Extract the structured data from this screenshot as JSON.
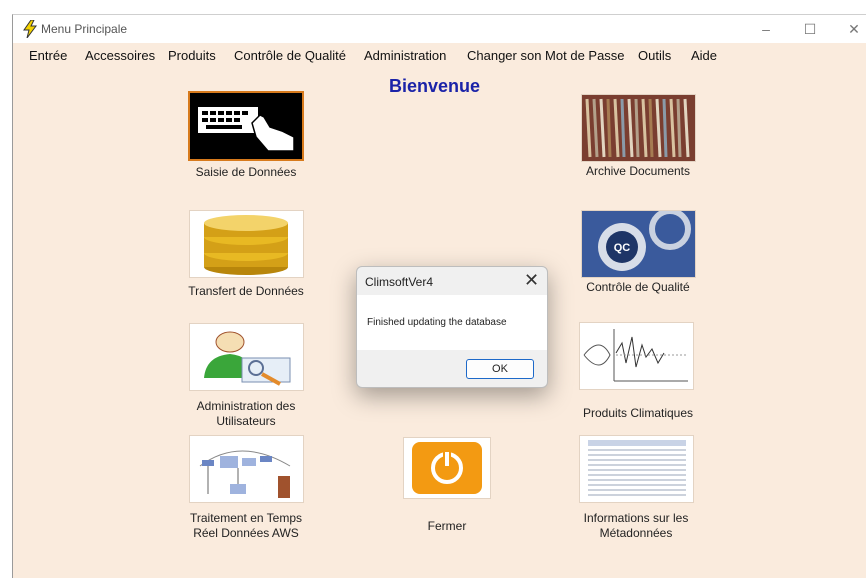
{
  "window": {
    "title": "Menu Principale"
  },
  "menu": [
    "Entrée",
    "Accessoires",
    "Produits",
    "Contrôle de Qualité",
    "Administration",
    "Changer son Mot de Passe",
    "Outils",
    "Aide"
  ],
  "welcome": "Bienvenue",
  "tiles": {
    "data_entry": "Saisie de Données",
    "data_transfer": "Transfert de Données",
    "user_admin_1": "Administration des",
    "user_admin_2": "Utilisateurs",
    "aws_1": "Traitement en Temps",
    "aws_2": "Réel Données AWS",
    "archive": "Archive Documents",
    "qc": "Contrôle de Qualité",
    "qc_badge": "QC",
    "climate": "Produits Climatiques",
    "meta_1": "Informations sur les",
    "meta_2": "Métadonnées",
    "close": "Fermer"
  },
  "dialog": {
    "title": "ClimsoftVer4",
    "message": "Finished updating the database",
    "ok": "OK"
  },
  "colors": {
    "accent": "#1b23a8",
    "background": "#faebdd",
    "fermer_orange": "#f39a12"
  }
}
